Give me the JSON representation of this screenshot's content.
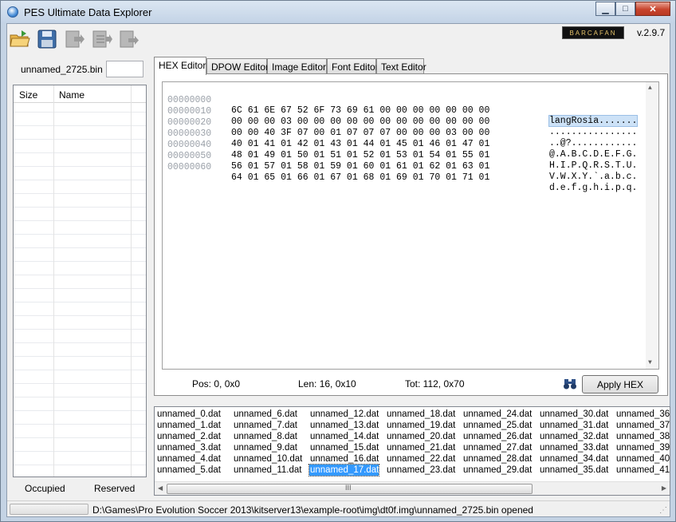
{
  "window": {
    "title": "PES Ultimate Data Explorer",
    "minimize": "▁",
    "maximize": "□",
    "close": "✕"
  },
  "toolbar": {
    "icons": [
      "open-folder-icon",
      "save-icon",
      "import-icon",
      "export-icon",
      "replace-icon"
    ],
    "banner": "BARCAFAN",
    "version": "v.2.9.7"
  },
  "left": {
    "filename": "unnamed_2725.bin",
    "columns": [
      "Size",
      "Name"
    ],
    "occupied_label": "Occupied",
    "reserved_label": "Reserved"
  },
  "tabs": [
    "HEX Editor",
    "DPOW Editor",
    "Image  Editor",
    "Font Editor",
    "Text Editor"
  ],
  "hex": {
    "rows": [
      {
        "offset": "00000000",
        "bytes": "6C 61 6E 67 52 6F 73 69 61 00 00 00 00 00 00 00",
        "ascii": "langRosia......."
      },
      {
        "offset": "00000010",
        "bytes": "00 00 00 03 00 00 00 00 00 00 00 00 00 00 00 00",
        "ascii": "................"
      },
      {
        "offset": "00000020",
        "bytes": "00 00 40 3F 07 00 01 07 07 07 00 00 00 03 00 00",
        "ascii": "..@?............"
      },
      {
        "offset": "00000030",
        "bytes": "40 01 41 01 42 01 43 01 44 01 45 01 46 01 47 01",
        "ascii": "@.A.B.C.D.E.F.G."
      },
      {
        "offset": "00000040",
        "bytes": "48 01 49 01 50 01 51 01 52 01 53 01 54 01 55 01",
        "ascii": "H.I.P.Q.R.S.T.U."
      },
      {
        "offset": "00000050",
        "bytes": "56 01 57 01 58 01 59 01 60 01 61 01 62 01 63 01",
        "ascii": "V.W.X.Y.`.a.b.c."
      },
      {
        "offset": "00000060",
        "bytes": "64 01 65 01 66 01 67 01 68 01 69 01 70 01 71 01",
        "ascii": "d.e.f.g.h.i.p.q."
      }
    ],
    "selected_ascii": "langRosia.......",
    "pos": "Pos: 0, 0x0",
    "len": "Len: 16, 0x10",
    "tot": "Tot: 112, 0x70",
    "apply_label": "Apply HEX"
  },
  "dat_files": {
    "columns": [
      [
        "unnamed_0.dat",
        "unnamed_1.dat",
        "unnamed_2.dat",
        "unnamed_3.dat",
        "unnamed_4.dat",
        "unnamed_5.dat"
      ],
      [
        "unnamed_6.dat",
        "unnamed_7.dat",
        "unnamed_8.dat",
        "unnamed_9.dat",
        "unnamed_10.dat",
        "unnamed_11.dat"
      ],
      [
        "unnamed_12.dat",
        "unnamed_13.dat",
        "unnamed_14.dat",
        "unnamed_15.dat",
        "unnamed_16.dat",
        "unnamed_17.dat"
      ],
      [
        "unnamed_18.dat",
        "unnamed_19.dat",
        "unnamed_20.dat",
        "unnamed_21.dat",
        "unnamed_22.dat",
        "unnamed_23.dat"
      ],
      [
        "unnamed_24.dat",
        "unnamed_25.dat",
        "unnamed_26.dat",
        "unnamed_27.dat",
        "unnamed_28.dat",
        "unnamed_29.dat"
      ],
      [
        "unnamed_30.dat",
        "unnamed_31.dat",
        "unnamed_32.dat",
        "unnamed_33.dat",
        "unnamed_34.dat",
        "unnamed_35.dat"
      ],
      [
        "unnamed_36.",
        "unnamed_37.",
        "unnamed_38.",
        "unnamed_39.",
        "unnamed_40.",
        "unnamed_41."
      ]
    ],
    "selected": "unnamed_17.dat",
    "scroll_thumb": "III"
  },
  "status": {
    "text": "D:\\Games\\Pro Evolution Soccer 2013\\kitserver13\\example-root\\img\\dt0f.img\\unnamed_2725.bin opened"
  }
}
